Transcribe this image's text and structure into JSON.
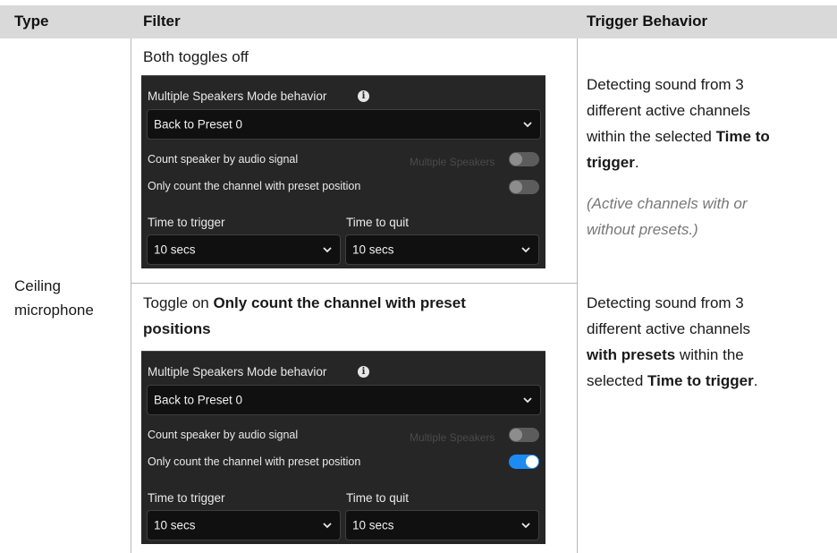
{
  "header": {
    "type": "Type",
    "filter": "Filter",
    "trigger": "Trigger Behavior"
  },
  "type_cell": {
    "line1": "Ceiling",
    "line2": "microphone"
  },
  "rows": [
    {
      "filter_caption": "Both toggles off",
      "panel": {
        "title": "Multiple Speakers Mode behavior",
        "mode_value": "Back to Preset 0",
        "toggle1_label": "Count speaker by audio signal",
        "toggle1_on": false,
        "toggle2_label": "Only count the channel with preset position",
        "toggle2_on": false,
        "time_to_trigger_label": "Time to trigger",
        "time_to_trigger_value": "10 secs",
        "time_to_quit_label": "Time to quit",
        "time_to_quit_value": "10 secs"
      },
      "trigger": {
        "l1": "Detecting sound from 3",
        "l2": "different active channels",
        "l3a": "within the selected ",
        "l3b": "Time to",
        "l4b": "trigger",
        "l4c": ".",
        "note1": "(Active channels with or",
        "note2": "without presets.)"
      }
    },
    {
      "filter_caption_pre": "Toggle on ",
      "filter_caption_bold1": "Only count the channel with preset",
      "filter_caption_bold2": "positions",
      "panel": {
        "title": "Multiple Speakers Mode behavior",
        "mode_value": "Back to Preset 0",
        "toggle1_label": "Count speaker by audio signal",
        "toggle1_on": false,
        "toggle2_label": "Only count the channel with preset position",
        "toggle2_on": true,
        "time_to_trigger_label": "Time to trigger",
        "time_to_trigger_value": "10 secs",
        "time_to_quit_label": "Time to quit",
        "time_to_quit_value": "10 secs"
      },
      "trigger": {
        "l1": "Detecting sound from 3",
        "l2": "different active channels",
        "l3b": "with presets",
        "l3c": " within the",
        "l4a": "selected ",
        "l4b": "Time to trigger",
        "l4c": "."
      }
    }
  ],
  "colors": {
    "toggle_on": "#1d8cf2",
    "panel_bg": "#262626",
    "header_bg": "#d9d9d9"
  }
}
